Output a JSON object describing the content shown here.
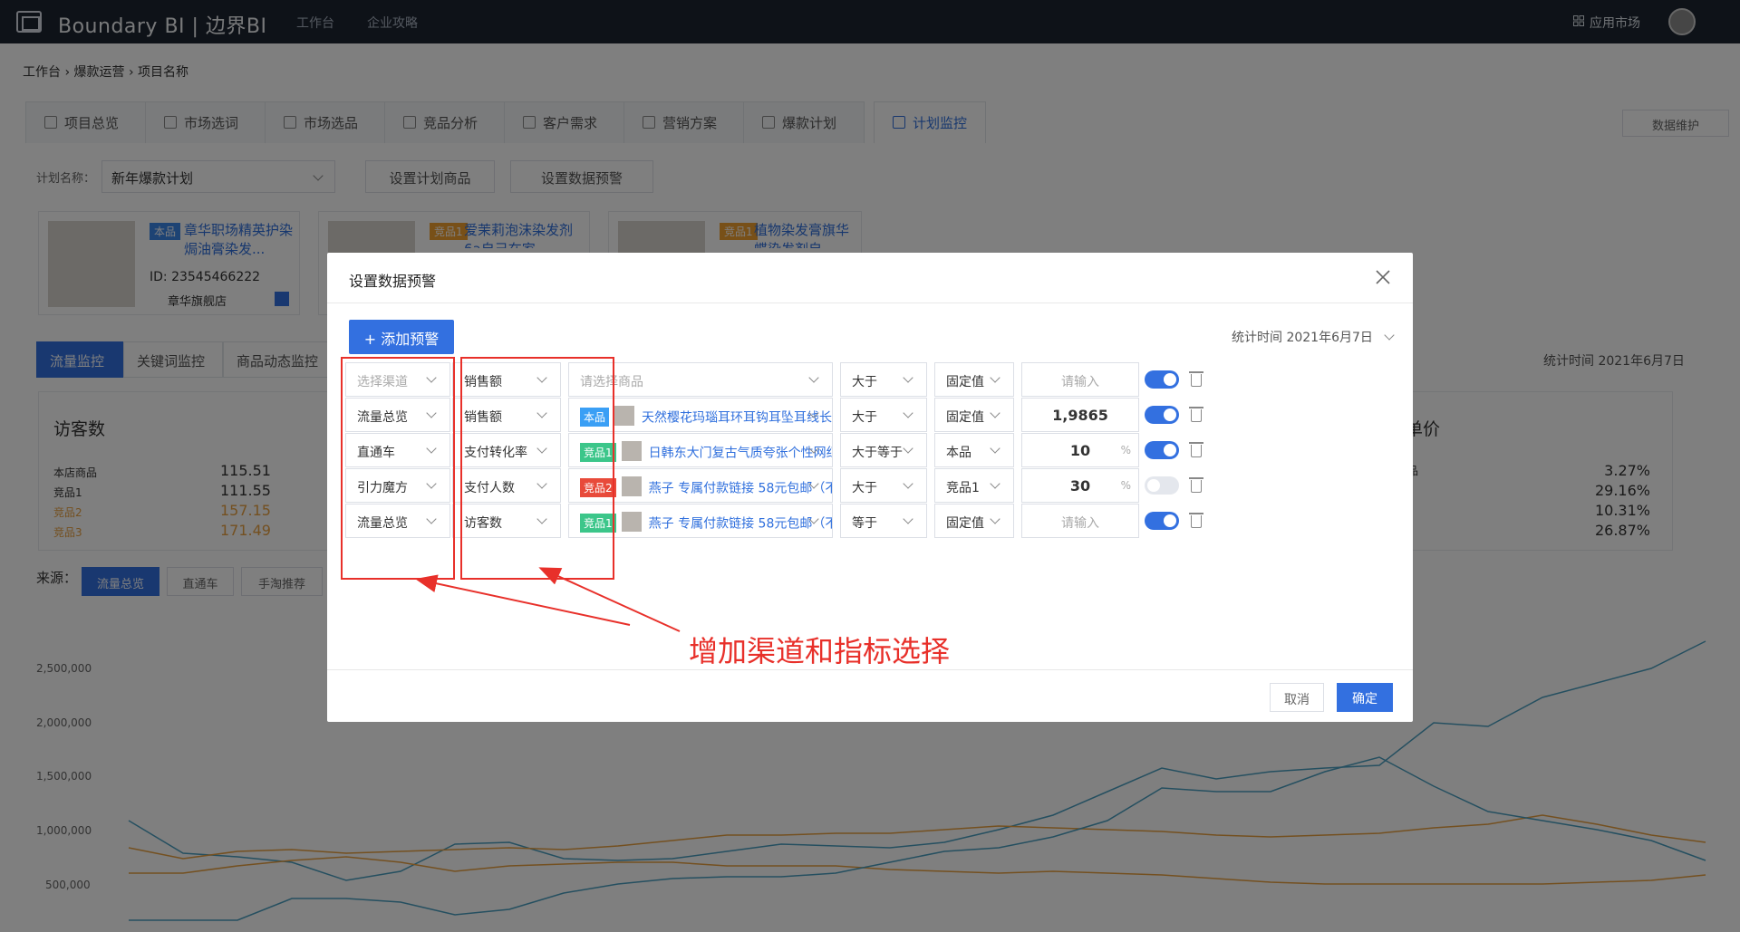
{
  "topbar": {
    "brand": "Boundary BI | 边界BI",
    "nav": [
      "工作台",
      "企业攻略"
    ],
    "app_market": "应用市场"
  },
  "breadcrumb": [
    "工作台",
    "爆款运营",
    "项目名称"
  ],
  "tabs": [
    {
      "label": "项目总览"
    },
    {
      "label": "市场选词"
    },
    {
      "label": "市场选品"
    },
    {
      "label": "竞品分析"
    },
    {
      "label": "客户需求"
    },
    {
      "label": "营销方案"
    },
    {
      "label": "爆款计划"
    },
    {
      "label": "计划监控"
    }
  ],
  "data_maintenance": "数据维护",
  "plan": {
    "label": "计划名称：",
    "value": "新年爆款计划",
    "set_products": "设置计划商品",
    "set_alert": "设置数据预警"
  },
  "products": [
    {
      "tag": "本品",
      "name": "章华职场精英护染焗油膏染发...",
      "id": "ID: 23545466222",
      "shop": "章华旗舰店",
      "tag_color": "#3a86e8"
    },
    {
      "tag": "竞品1",
      "name": "爱茉莉泡沫染发剂6a自己在家",
      "tag_color": "#f0a030"
    },
    {
      "tag": "竞品1",
      "name": "植物染发膏旗华蝶染发剂自",
      "tag_color": "#f0a030"
    }
  ],
  "sub_tabs": [
    "流量监控",
    "关键词监控",
    "商品动态监控"
  ],
  "background_stat_time": "统计时间 2021年6月7日",
  "visitor_card": {
    "title": "访客数",
    "rows": [
      {
        "label": "本店商品",
        "value": "115.51"
      },
      {
        "label": "竞品1",
        "value": "111.55"
      },
      {
        "label": "竞品2",
        "value": "157.15"
      },
      {
        "label": "竞品3",
        "value": "171.49"
      }
    ]
  },
  "price_card": {
    "title": "单价",
    "rows": [
      {
        "label": "品",
        "value": "3.27%"
      },
      {
        "value": "29.16%"
      },
      {
        "value": "10.31%"
      },
      {
        "value": "26.87%"
      }
    ]
  },
  "source": {
    "label": "来源：",
    "buttons": [
      "流量总览",
      "直通车",
      "手淘推荐"
    ]
  },
  "bg_chart": {
    "y_ticks": [
      "2,500,000",
      "2,000,000",
      "1,500,000",
      "1,000,000",
      "500,000"
    ],
    "colors": [
      "#4a9fc0",
      "#e8a040",
      "#c87f4a"
    ]
  },
  "modal": {
    "title": "设置数据预警",
    "add_alert": "+ 添加预警",
    "stat_time": "统计时间 2021年6月7日",
    "cancel": "取消",
    "confirm": "确定",
    "rows": [
      {
        "channel": "选择渠道",
        "channel_placeholder": true,
        "metric": "销售额",
        "product_placeholder": "请选择商品",
        "cond": "大于",
        "ref": "固定值",
        "input_placeholder": "请输入",
        "enabled": true
      },
      {
        "channel": "流量总览",
        "metric": "销售额",
        "product_tag": "本品",
        "product_tag_color": "#3a9ff5",
        "product_name": "天然樱花玛瑙耳环耳钩耳坠耳线长...",
        "cond": "大于",
        "ref": "固定值",
        "value": "1,9865",
        "enabled": true
      },
      {
        "channel": "直通车",
        "metric": "支付转化率",
        "product_tag": "竞品1",
        "product_tag_color": "#3cc68a",
        "product_name": "日韩东大门复古气质夸张个性网红...",
        "cond": "大于等于",
        "ref": "本品",
        "value": "10",
        "unit": "%",
        "enabled": true
      },
      {
        "channel": "引力魔方",
        "metric": "支付人数",
        "product_tag": "竞品2",
        "product_tag_color": "#e84a3a",
        "product_name": "燕子 专属付款链接 58元包邮（不...",
        "cond": "大于",
        "ref": "竞品1",
        "value": "30",
        "unit": "%",
        "enabled": false
      },
      {
        "channel": "流量总览",
        "metric": "访客数",
        "product_tag": "竞品1",
        "product_tag_color": "#3cc68a",
        "product_name": "燕子 专属付款链接 58元包邮（不...",
        "cond": "等于",
        "ref": "固定值",
        "input_placeholder": "请输入",
        "enabled": true
      }
    ]
  },
  "annotation": {
    "text": "增加渠道和指标选择",
    "color": "#e8302a"
  }
}
